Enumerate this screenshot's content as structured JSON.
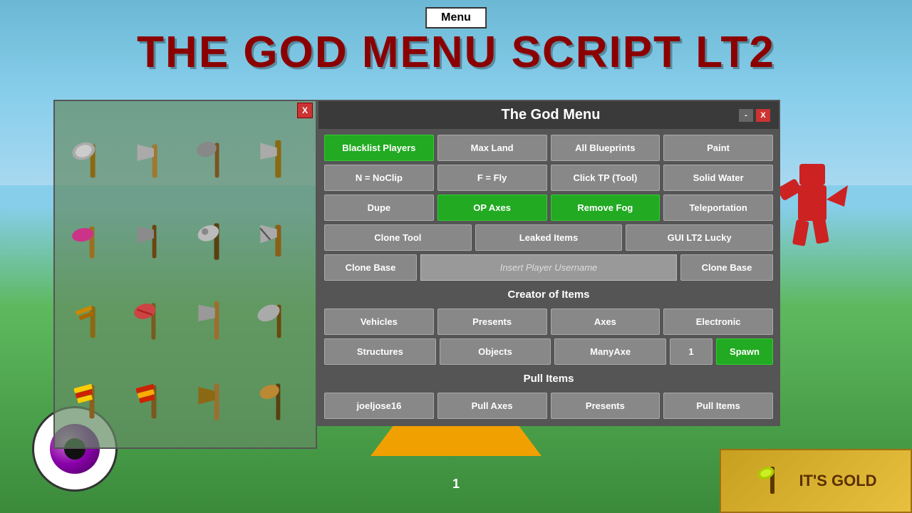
{
  "background": {
    "sky_color": "#87ceeb",
    "ground_color": "#4a9e4a"
  },
  "page_title": "THE GOD MENU SCRIPT LT2",
  "menu_button": "Menu",
  "left_panel": {
    "close_label": "X"
  },
  "main_panel": {
    "title": "The God Menu",
    "minimize_label": "-",
    "close_label": "X",
    "row1": [
      {
        "label": "Blacklist Players",
        "style": "green"
      },
      {
        "label": "Max Land",
        "style": "normal"
      },
      {
        "label": "All Blueprints",
        "style": "normal"
      },
      {
        "label": "Paint",
        "style": "normal"
      }
    ],
    "row2": [
      {
        "label": "N = NoClip",
        "style": "normal"
      },
      {
        "label": "F = Fly",
        "style": "normal"
      },
      {
        "label": "Click TP (Tool)",
        "style": "normal"
      },
      {
        "label": "Solid Water",
        "style": "normal"
      }
    ],
    "row3": [
      {
        "label": "Dupe",
        "style": "normal"
      },
      {
        "label": "OP Axes",
        "style": "green"
      },
      {
        "label": "Remove Fog",
        "style": "green"
      },
      {
        "label": "Teleportation",
        "style": "normal"
      }
    ],
    "row4": [
      {
        "label": "Clone Tool",
        "style": "normal"
      },
      {
        "label": "Leaked Items",
        "style": "normal"
      },
      {
        "label": "GUI LT2 Lucky",
        "style": "normal"
      }
    ],
    "clone_row": {
      "clone_base_label": "Clone Base",
      "username_placeholder": "Insert Player Username",
      "clone_base_btn_label": "Clone Base"
    },
    "creator_section": {
      "header": "Creator of Items",
      "row1": [
        {
          "label": "Vehicles",
          "style": "normal"
        },
        {
          "label": "Presents",
          "style": "normal"
        },
        {
          "label": "Axes",
          "style": "normal"
        },
        {
          "label": "Electronic",
          "style": "normal"
        }
      ],
      "row2_label": "Structures",
      "row2_objects": "Objects",
      "row2_manyaxe": "ManyAxe",
      "row2_count": "1",
      "row2_spawn": "Spawn"
    },
    "pull_section": {
      "header": "Pull Items",
      "items": [
        {
          "label": "joeljose16",
          "style": "normal"
        },
        {
          "label": "Pull Axes",
          "style": "normal"
        },
        {
          "label": "Presents",
          "style": "normal"
        },
        {
          "label": "Pull Items",
          "style": "normal"
        }
      ]
    }
  },
  "gold_item": {
    "text": "IT'S GOLD"
  },
  "counter": "1"
}
